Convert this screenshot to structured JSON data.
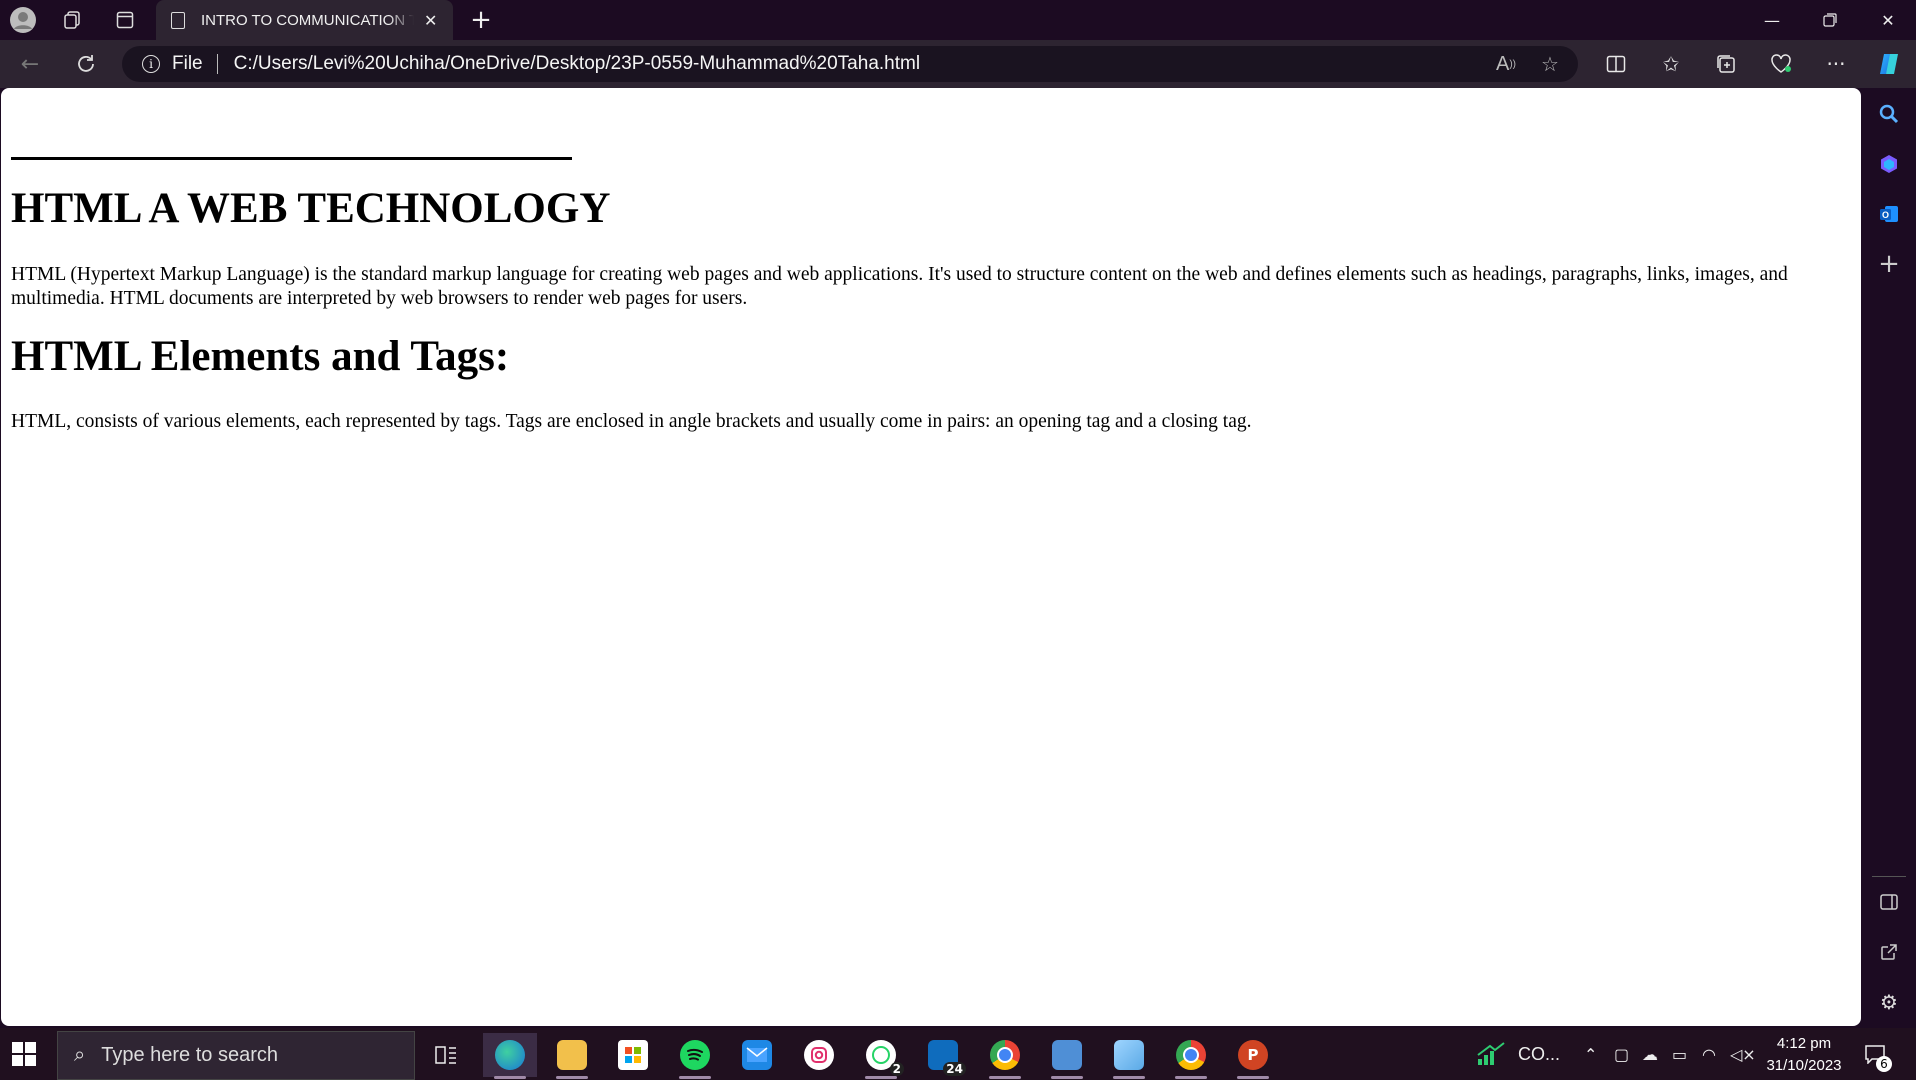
{
  "browser": {
    "tab_title": "INTRO TO COMMUNICATION TECHNOLOGY",
    "address_scheme_label": "File",
    "url": "C:/Users/Levi%20Uchiha/OneDrive/Desktop/23P-0559-Muhammad%20Taha.html"
  },
  "page": {
    "heading1": "HTML A WEB TECHNOLOGY",
    "paragraph1": "HTML (Hypertext Markup Language) is the standard markup language for creating web pages and web applications. It's used to structure content on the web and defines elements such as headings, paragraphs, links, images, and multimedia. HTML documents are interpreted by web browsers to render web pages for users.",
    "heading2": "HTML Elements and Tags:",
    "paragraph2": "HTML, consists of various elements, each represented by tags. Tags are enclosed in angle brackets and usually come in pairs: an opening tag and a closing tag."
  },
  "taskbar": {
    "search_placeholder": "Type here to search",
    "whatsapp_badge": "2",
    "mail_badge": "24",
    "stocks_label": "CO...",
    "time": "4:12 pm",
    "date": "31/10/2023",
    "notifications_badge": "6"
  },
  "icons": {
    "profile": "profile-icon",
    "workspaces": "workspaces-icon",
    "tab_actions": "tab-actions-icon",
    "doc": "document-icon",
    "close": "close-icon",
    "new_tab": "plus-icon",
    "back": "back-arrow-icon",
    "refresh": "refresh-icon",
    "info": "info-icon",
    "read_aloud": "read-aloud-icon",
    "favorite": "star-icon",
    "split": "split-screen-icon",
    "favorites": "favorites-icon",
    "collections": "collections-icon",
    "health": "browser-essentials-icon",
    "more": "more-icon",
    "copilot": "copilot-icon"
  },
  "colors": {
    "titlebar": "#1c0b22",
    "toolbar": "#2d2431",
    "page_bg": "#ffffff",
    "taskbar": "#20101f"
  }
}
